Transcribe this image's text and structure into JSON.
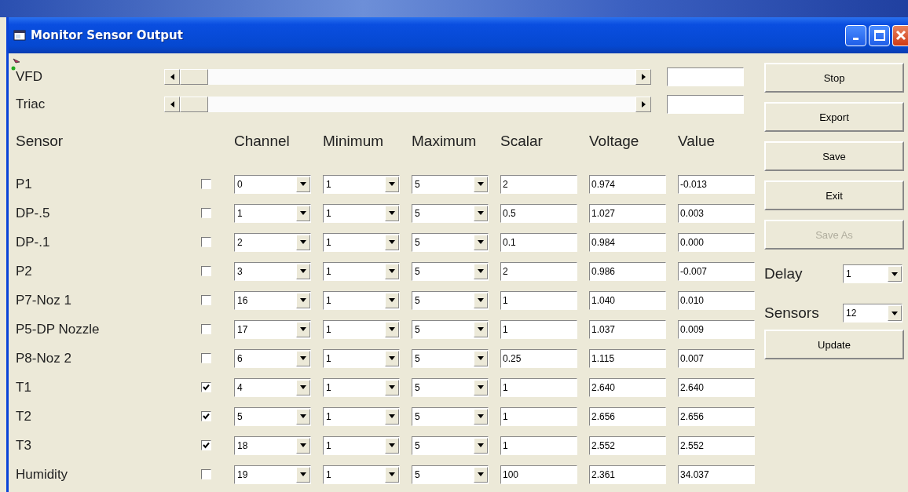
{
  "window": {
    "title": "Monitor Sensor Output"
  },
  "sliders": [
    {
      "label": "VFD",
      "level": 0
    },
    {
      "label": "Triac",
      "level": 0
    }
  ],
  "columns": [
    "Sensor",
    "Channel",
    "Minimum",
    "Maximum",
    "Scalar",
    "Voltage",
    "Value"
  ],
  "rows": [
    {
      "name": "P1",
      "checked": false,
      "channel": "0",
      "minimum": "1",
      "maximum": "5",
      "scalar": "2",
      "voltage": "0.974",
      "value": "-0.013"
    },
    {
      "name": "DP-.5",
      "checked": false,
      "channel": "1",
      "minimum": "1",
      "maximum": "5",
      "scalar": "0.5",
      "voltage": "1.027",
      "value": "0.003"
    },
    {
      "name": "DP-.1",
      "checked": false,
      "channel": "2",
      "minimum": "1",
      "maximum": "5",
      "scalar": "0.1",
      "voltage": "0.984",
      "value": "0.000"
    },
    {
      "name": "P2",
      "checked": false,
      "channel": "3",
      "minimum": "1",
      "maximum": "5",
      "scalar": "2",
      "voltage": "0.986",
      "value": "-0.007"
    },
    {
      "name": "P7-Noz 1",
      "checked": false,
      "channel": "16",
      "minimum": "1",
      "maximum": "5",
      "scalar": "1",
      "voltage": "1.040",
      "value": "0.010"
    },
    {
      "name": "P5-DP Nozzle",
      "checked": false,
      "channel": "17",
      "minimum": "1",
      "maximum": "5",
      "scalar": "1",
      "voltage": "1.037",
      "value": "0.009"
    },
    {
      "name": "P8-Noz 2",
      "checked": false,
      "channel": "6",
      "minimum": "1",
      "maximum": "5",
      "scalar": "0.25",
      "voltage": "1.115",
      "value": "0.007"
    },
    {
      "name": "T1",
      "checked": true,
      "channel": "4",
      "minimum": "1",
      "maximum": "5",
      "scalar": "1",
      "voltage": "2.640",
      "value": "2.640"
    },
    {
      "name": "T2",
      "checked": true,
      "channel": "5",
      "minimum": "1",
      "maximum": "5",
      "scalar": "1",
      "voltage": "2.656",
      "value": "2.656"
    },
    {
      "name": "T3",
      "checked": true,
      "channel": "18",
      "minimum": "1",
      "maximum": "5",
      "scalar": "1",
      "voltage": "2.552",
      "value": "2.552"
    },
    {
      "name": "Humidity",
      "checked": false,
      "channel": "19",
      "minimum": "1",
      "maximum": "5",
      "scalar": "100",
      "voltage": "2.361",
      "value": "34.037"
    }
  ],
  "buttons": [
    {
      "label": "Stop",
      "disabled": false
    },
    {
      "label": "Export",
      "disabled": false
    },
    {
      "label": "Save",
      "disabled": false
    },
    {
      "label": "Exit",
      "disabled": false
    },
    {
      "label": "Save As",
      "disabled": true
    }
  ],
  "delay": {
    "label": "Delay",
    "value": "1"
  },
  "sensors": {
    "label": "Sensors",
    "value": "12"
  },
  "update_button": "Update"
}
